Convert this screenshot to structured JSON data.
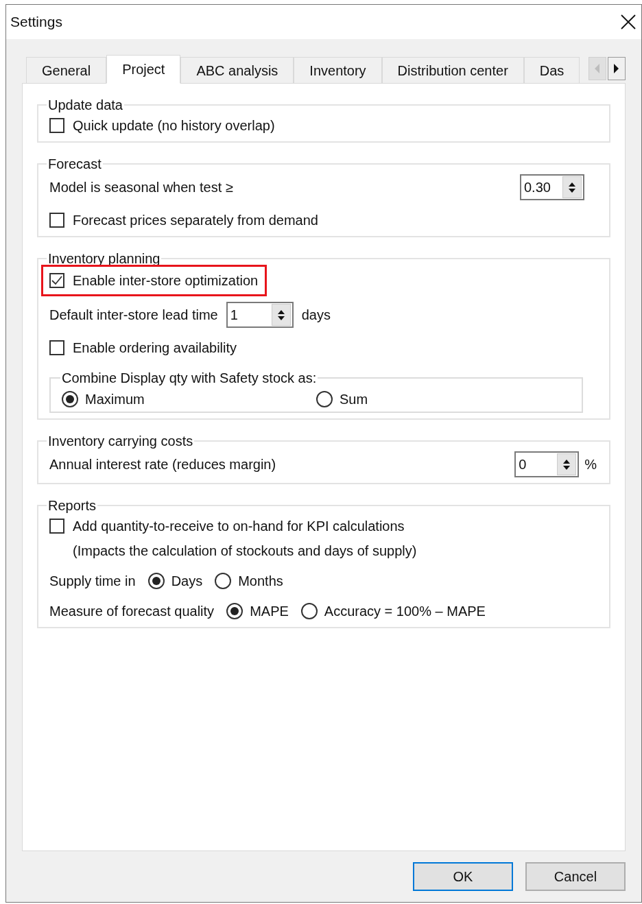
{
  "window": {
    "title": "Settings"
  },
  "tabs": [
    {
      "label": "General",
      "selected": false
    },
    {
      "label": "Project",
      "selected": true
    },
    {
      "label": "ABC analysis",
      "selected": false
    },
    {
      "label": "Inventory",
      "selected": false
    },
    {
      "label": "Distribution center",
      "selected": false
    },
    {
      "label": "Das",
      "selected": false
    }
  ],
  "groups": [
    {
      "title": "Update data",
      "items": [
        {
          "kind": "checkbox",
          "label": "Quick update (no history overlap)",
          "checked": false,
          "highlighted": false
        }
      ]
    },
    {
      "title": "Forecast",
      "items": [
        {
          "kind": "spinner_right",
          "label": "Model is seasonal when test ≥",
          "value": "0.30"
        },
        {
          "kind": "checkbox",
          "label": "Forecast prices separately from demand",
          "checked": false,
          "highlighted": false
        }
      ]
    },
    {
      "title": "Inventory planning",
      "items": [
        {
          "kind": "checkbox",
          "label": "Enable inter-store optimization",
          "checked": true,
          "highlighted": true
        },
        {
          "kind": "spinner",
          "label": "Default inter-store lead time",
          "value": "1",
          "unit": "days"
        },
        {
          "kind": "checkbox",
          "label": "Enable ordering availability",
          "checked": false,
          "highlighted": false
        },
        {
          "kind": "radio_frame",
          "title": "Combine Display qty with Safety stock as:",
          "options": [
            {
              "label": "Maximum",
              "selected": true
            },
            {
              "label": "Sum",
              "selected": false
            }
          ]
        }
      ]
    },
    {
      "title": "Inventory carrying costs",
      "items": [
        {
          "kind": "spinner_right",
          "label": "Annual interest rate (reduces margin)",
          "value": "0",
          "unit": "%"
        }
      ]
    },
    {
      "title": "Reports",
      "items": [
        {
          "kind": "checkbox",
          "label": "Add quantity-to-receive to on-hand for KPI calculations",
          "note": "(Impacts the calculation of stockouts and days of supply)",
          "checked": false,
          "highlighted": false
        },
        {
          "kind": "radio_row",
          "label": "Supply time in",
          "options": [
            {
              "label": "Days",
              "selected": true
            },
            {
              "label": "Months",
              "selected": false
            }
          ]
        },
        {
          "kind": "radio_row",
          "label": "Measure of forecast quality",
          "options": [
            {
              "label": "MAPE",
              "selected": true
            },
            {
              "label": "Accuracy = 100% – MAPE",
              "selected": false
            }
          ]
        }
      ]
    }
  ],
  "buttons": [
    {
      "label": "OK",
      "default": true
    },
    {
      "label": "Cancel",
      "default": false
    }
  ]
}
